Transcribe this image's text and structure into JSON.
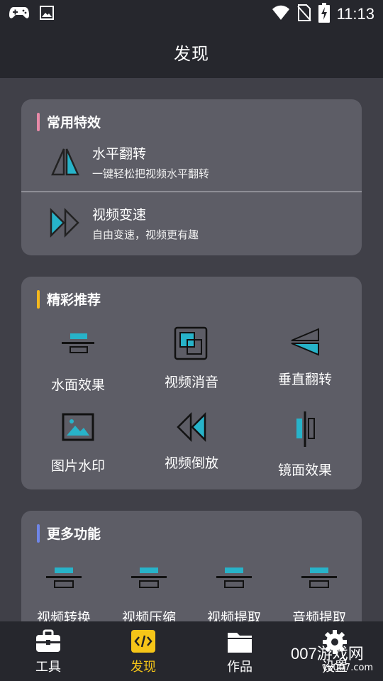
{
  "status_bar": {
    "time": "11:13",
    "left_icons": [
      "gamepad-icon",
      "image-icon"
    ],
    "right_icons": [
      "wifi-icon",
      "no-sim-icon",
      "battery-charging-icon"
    ]
  },
  "header": {
    "title": "发现"
  },
  "common_effects": {
    "title": "常用特效",
    "accent_color": "#e88aa8",
    "items": [
      {
        "icon": "mirror-flip-icon",
        "title": "水平翻转",
        "desc": "一键轻松把视频水平翻转"
      },
      {
        "icon": "fast-forward-icon",
        "title": "视频变速",
        "desc": "自由变速，视频更有趣"
      }
    ]
  },
  "recommended": {
    "title": "精彩推荐",
    "accent_color": "#f5b81c",
    "items": [
      {
        "icon": "water-reflection-icon",
        "label": "水面效果"
      },
      {
        "icon": "mute-video-icon",
        "label": "视频消音"
      },
      {
        "icon": "vertical-flip-icon",
        "label": "垂直翻转"
      },
      {
        "icon": "picture-watermark-icon",
        "label": "图片水印"
      },
      {
        "icon": "rewind-icon",
        "label": "视频倒放"
      },
      {
        "icon": "mirror-effect-icon",
        "label": "镜面效果"
      }
    ]
  },
  "more_functions": {
    "title": "更多功能",
    "accent_color": "#6f86e8",
    "items": [
      {
        "icon": "tool-generic-icon",
        "label": "视频转换"
      },
      {
        "icon": "tool-generic-icon",
        "label": "视频压缩"
      },
      {
        "icon": "tool-generic-icon",
        "label": "视频提取"
      },
      {
        "icon": "tool-generic-icon",
        "label": "音频提取"
      }
    ]
  },
  "bottom_nav": {
    "active_color": "#f5c518",
    "items": [
      {
        "icon": "toolbox-icon",
        "label": "工具"
      },
      {
        "icon": "code-icon",
        "label": "发现",
        "active": true
      },
      {
        "icon": "folder-icon",
        "label": "作品"
      },
      {
        "icon": "gear-icon",
        "label": "设置"
      }
    ]
  },
  "watermark": {
    "text": "007游戏网",
    "sub": "yx007.com"
  },
  "colors": {
    "teal": "#27b3c9",
    "card": "#5d5d66",
    "background": "#404048",
    "bar": "#26272d"
  }
}
